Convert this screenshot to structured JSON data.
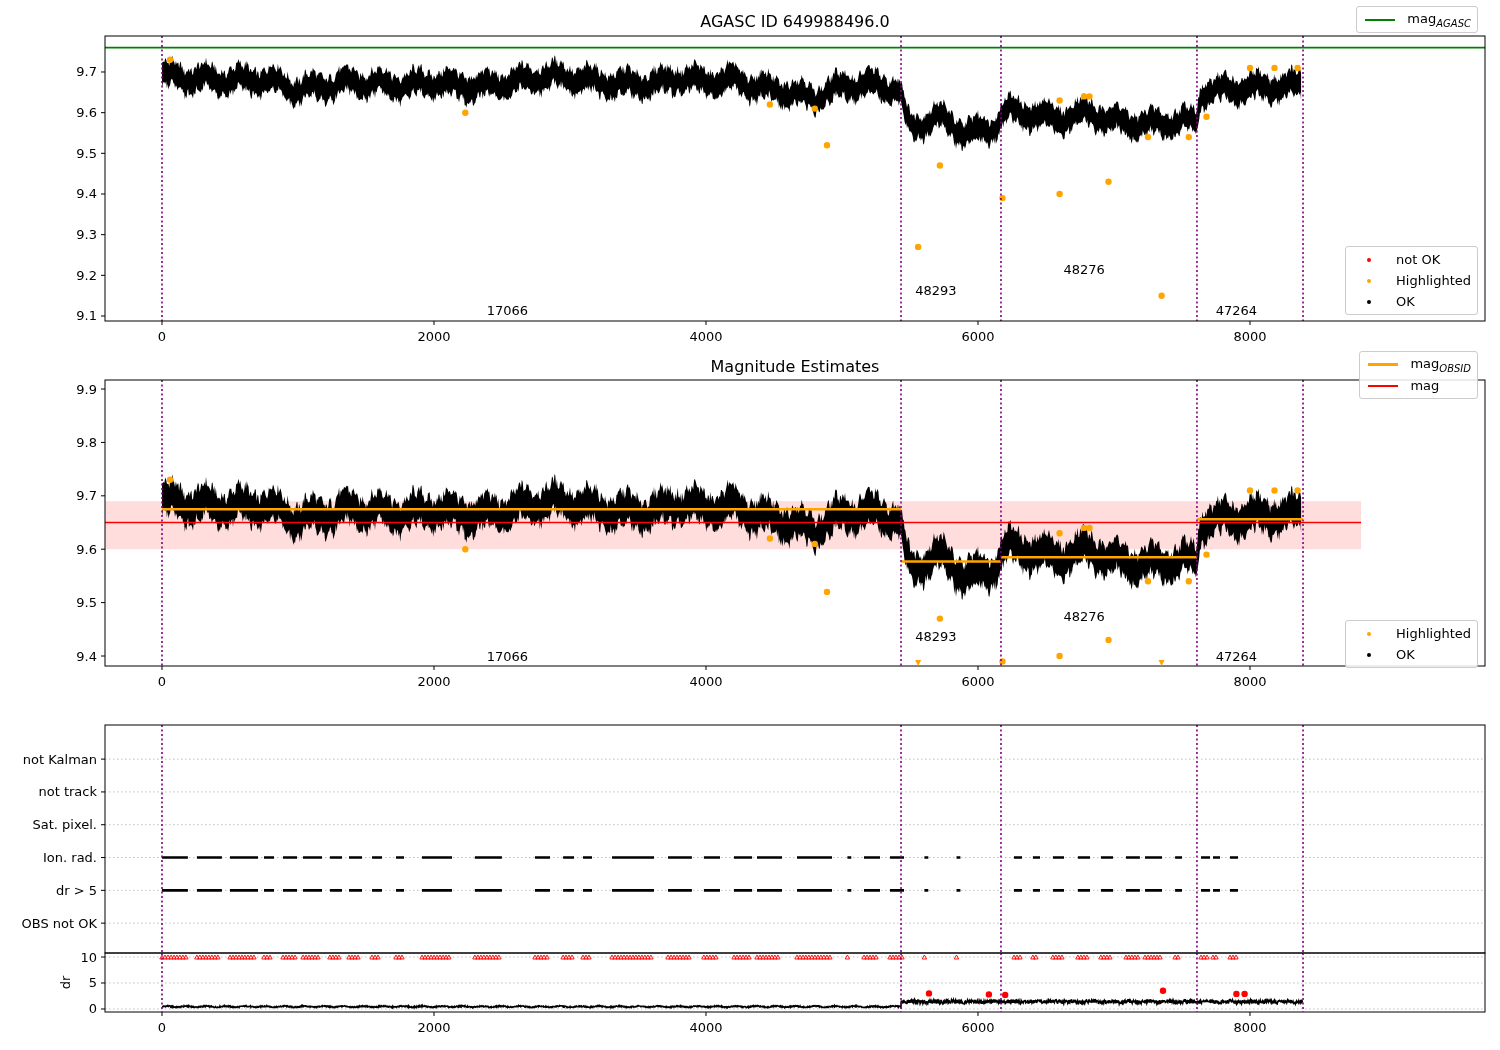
{
  "figure": {
    "panels": [
      {
        "chart_data": {
          "type": "scatter",
          "title": "AGASC ID 649988496.0",
          "xlim": [
            -419,
            9728
          ],
          "ylim": [
            9.0877,
            9.7885
          ],
          "xticks": [
            0,
            2000,
            4000,
            6000,
            8000
          ],
          "yticks": [
            9.1,
            9.2,
            9.3,
            9.4,
            9.5,
            9.6,
            9.7
          ],
          "series": [
            {
              "name": "not OK",
              "color": "#ff0000"
            },
            {
              "name": "Highlighted",
              "color": "#ffa500",
              "x": [
                60,
                2230,
                4470,
                4800,
                4890,
                5560,
                5720,
                6180,
                6600,
                6600,
                6780,
                6820,
                6960,
                7250,
                7350,
                7550,
                7680,
                8000,
                8180,
                8350
              ],
              "values": [
                9.73,
                9.6,
                9.62,
                9.61,
                9.52,
                9.27,
                9.47,
                9.39,
                9.63,
                9.4,
                9.64,
                9.64,
                9.43,
                9.54,
                9.15,
                9.54,
                9.59,
                9.71,
                9.71,
                9.71
              ]
            },
            {
              "name": "OK",
              "color": "#000000"
            }
          ],
          "ref_lines": [
            {
              "axis": "y",
              "value": 9.76,
              "label": "mag$_{AGASC}$",
              "color": "#008000"
            },
            {
              "axis": "x",
              "value": 0,
              "color": "#800080"
            },
            {
              "axis": "x",
              "value": 5434,
              "color": "#800080"
            },
            {
              "axis": "x",
              "value": 6169,
              "color": "#800080"
            },
            {
              "axis": "x",
              "value": 7610,
              "color": "#800080"
            },
            {
              "axis": "x",
              "value": 8390,
              "color": "#800080"
            }
          ],
          "annotations": [
            "17066",
            "48293",
            "48276",
            "47264"
          ]
        }
      },
      {
        "chart_data": {
          "type": "scatter",
          "title": "Magnitude Estimates",
          "xlim": [
            -419,
            9728
          ],
          "ylim": [
            9.3813,
            9.9169
          ],
          "xticks": [
            0,
            2000,
            4000,
            6000,
            8000
          ],
          "yticks": [
            9.4,
            9.5,
            9.6,
            9.7,
            9.8,
            9.9
          ],
          "series": [
            {
              "name": "mag$_{OBSID}$",
              "type": "line",
              "color": "#ffa500",
              "x": [
                0,
                5434,
                null,
                5434,
                6169,
                null,
                6169,
                7610,
                null,
                7610,
                8390
              ],
              "values": [
                9.675,
                9.675,
                null,
                9.577,
                9.577,
                null,
                9.585,
                9.585,
                null,
                9.656,
                9.656
              ]
            },
            {
              "name": "Highlighted",
              "color": "#ffa500",
              "x": [
                60,
                2230,
                4470,
                4800,
                4890,
                5560,
                5720,
                6180,
                6600,
                6600,
                6780,
                6820,
                6960,
                7250,
                7350,
                7550,
                7680,
                8000,
                8180,
                8350
              ],
              "values": [
                9.73,
                9.6,
                9.62,
                9.61,
                9.52,
                null,
                9.47,
                9.39,
                9.63,
                9.4,
                9.64,
                9.64,
                9.43,
                9.54,
                null,
                9.54,
                9.59,
                9.71,
                9.71,
                9.71
              ]
            },
            {
              "name": "OK",
              "color": "#000000"
            }
          ],
          "ref_lines": [
            {
              "axis": "y",
              "value": 9.65,
              "label": "mag",
              "color": "#ff0000"
            },
            {
              "axis": "x",
              "value": 0,
              "color": "#800080"
            },
            {
              "axis": "x",
              "value": 5434,
              "color": "#800080"
            },
            {
              "axis": "x",
              "value": 6169,
              "color": "#800080"
            },
            {
              "axis": "x",
              "value": 7610,
              "color": "#800080"
            },
            {
              "axis": "x",
              "value": 8390,
              "color": "#800080"
            }
          ],
          "bands": [
            {
              "axis": "y",
              "from": 9.6,
              "to": 9.69,
              "color": "#ffdddd"
            }
          ],
          "annotations": [
            "17066",
            "48293",
            "48276",
            "47264"
          ]
        }
      },
      {
        "flag_rows": [
          {
            "label": "not Kalman",
            "flagged": false
          },
          {
            "label": "not track",
            "flagged": false
          },
          {
            "label": "Sat. pixel.",
            "flagged": false
          },
          {
            "label": "Ion. rad.",
            "flagged": true
          },
          {
            "label": "dr > 5",
            "flagged": true
          },
          {
            "label": "OBS not OK",
            "flagged": false
          }
        ]
      },
      {
        "chart_data": {
          "type": "scatter",
          "ylabel": "dr",
          "grid": true,
          "xlim": [
            -419,
            9728
          ],
          "ylim": [
            -0.58,
            10.77
          ],
          "xticks": [
            0,
            2000,
            4000,
            6000,
            8000
          ],
          "yticks": [
            0,
            5,
            10
          ],
          "series": [
            {
              "color": "#ff0000",
              "x": [
                5640,
                6080,
                6200,
                7360,
                7900,
                7960
              ],
              "values": [
                3,
                2.8,
                2.7,
                3.5,
                2.9,
                2.9
              ]
            }
          ],
          "ref_lines": [
            {
              "axis": "x",
              "value": 0,
              "color": "#800080"
            },
            {
              "axis": "x",
              "value": 5434,
              "color": "#800080"
            },
            {
              "axis": "x",
              "value": 6169,
              "color": "#800080"
            },
            {
              "axis": "x",
              "value": 7610,
              "color": "#800080"
            },
            {
              "axis": "x",
              "value": 8390,
              "color": "#800080"
            }
          ]
        }
      }
    ]
  }
}
